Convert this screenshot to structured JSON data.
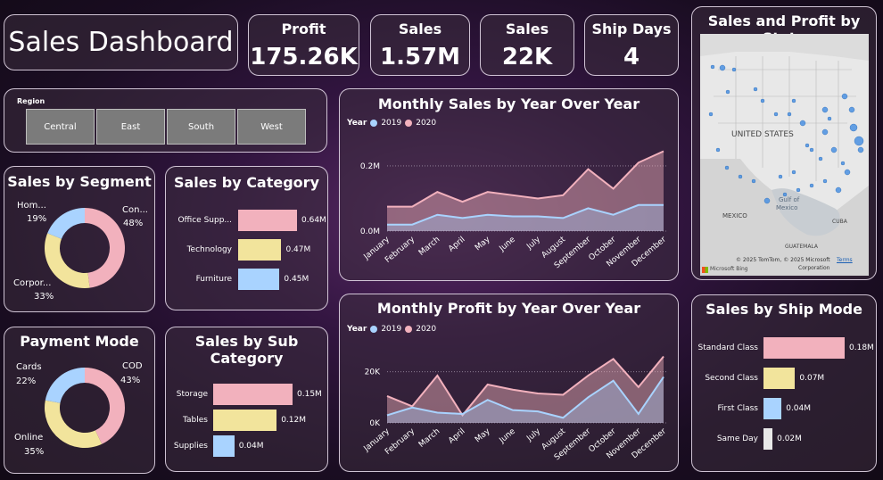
{
  "title": "Sales Dashboard",
  "kpis": {
    "profit": {
      "label": "Profit",
      "value": "175.26K"
    },
    "sales_amount": {
      "label": "Sales",
      "value": "1.57M"
    },
    "sales_count": {
      "label": "Sales",
      "value": "22K"
    },
    "ship_days": {
      "label": "Ship Days",
      "value": "4"
    }
  },
  "region": {
    "label": "Region",
    "options": [
      "Central",
      "East",
      "South",
      "West"
    ]
  },
  "segment": {
    "title": "Sales by Segment",
    "slices": [
      {
        "name": "Con...",
        "pct": "48%",
        "value": 48,
        "color": "#f2b1bd"
      },
      {
        "name": "Corpor...",
        "pct": "33%",
        "value": 33,
        "color": "#f2e49c"
      },
      {
        "name": "Hom...",
        "pct": "19%",
        "value": 19,
        "color": "#a9d3ff"
      }
    ]
  },
  "payment": {
    "title": "Payment Mode",
    "slices": [
      {
        "name": "COD",
        "pct": "43%",
        "value": 43,
        "color": "#f2b1bd"
      },
      {
        "name": "Online",
        "pct": "35%",
        "value": 35,
        "color": "#f2e49c"
      },
      {
        "name": "Cards",
        "pct": "22%",
        "value": 22,
        "color": "#a9d3ff"
      }
    ]
  },
  "category": {
    "title": "Sales by Category",
    "bars": [
      {
        "label": "Office Supp...",
        "value": 0.64,
        "text": "0.64M",
        "color": "#f2b1bd"
      },
      {
        "label": "Technology",
        "value": 0.47,
        "text": "0.47M",
        "color": "#f2e49c"
      },
      {
        "label": "Furniture",
        "value": 0.45,
        "text": "0.45M",
        "color": "#a9d3ff"
      }
    ]
  },
  "subcategory": {
    "title_line1": "Sales by Sub",
    "title_line2": "Category",
    "bars": [
      {
        "label": "Storage",
        "value": 0.15,
        "text": "0.15M",
        "color": "#f2b1bd"
      },
      {
        "label": "Tables",
        "value": 0.12,
        "text": "0.12M",
        "color": "#f2e49c"
      },
      {
        "label": "Supplies",
        "value": 0.04,
        "text": "0.04M",
        "color": "#a9d3ff"
      }
    ]
  },
  "shipmode": {
    "title": "Sales by Ship Mode",
    "bars": [
      {
        "label": "Standard Class",
        "value": 0.18,
        "text": "0.18M",
        "color": "#f2b1bd"
      },
      {
        "label": "Second Class",
        "value": 0.07,
        "text": "0.07M",
        "color": "#f2e49c"
      },
      {
        "label": "First Class",
        "value": 0.04,
        "text": "0.04M",
        "color": "#a9d3ff"
      },
      {
        "label": "Same Day",
        "value": 0.02,
        "text": "0.02M",
        "color": "#e8e8e8"
      }
    ]
  },
  "map": {
    "title": "Sales and Profit by State",
    "labels": {
      "country": "UNITED STATES",
      "gulf1": "Gulf of",
      "gulf2": "Mexico",
      "mexico": "MEXICO",
      "guatemala": "GUATEMALA",
      "cuba": "CUBA",
      "copyright": "© 2025 TomTom, © 2025 Microsoft",
      "corporation": "Corporation",
      "terms": "Terms",
      "bing": "Microsoft Bing"
    }
  },
  "chart_data": [
    {
      "type": "area",
      "title": "Monthly Sales by Year Over Year",
      "legend_title": "Year",
      "categories": [
        "January",
        "February",
        "March",
        "April",
        "May",
        "June",
        "July",
        "August",
        "September",
        "October",
        "November",
        "December"
      ],
      "yticks": [
        "0.0M",
        "0.2M"
      ],
      "ylim": [
        0,
        0.26
      ],
      "series": [
        {
          "name": "2019",
          "color": "#a9d3ff",
          "values": [
            0.02,
            0.02,
            0.05,
            0.04,
            0.05,
            0.045,
            0.045,
            0.04,
            0.07,
            0.05,
            0.08,
            0.08
          ]
        },
        {
          "name": "2020",
          "color": "#f2b1bd",
          "values": [
            0.075,
            0.075,
            0.12,
            0.09,
            0.12,
            0.11,
            0.1,
            0.11,
            0.19,
            0.13,
            0.21,
            0.245
          ]
        }
      ]
    },
    {
      "type": "area",
      "title": "Monthly Profit by Year Over Year",
      "legend_title": "Year",
      "categories": [
        "January",
        "February",
        "March",
        "April",
        "May",
        "June",
        "July",
        "August",
        "September",
        "October",
        "November",
        "December"
      ],
      "yticks": [
        "0K",
        "20K"
      ],
      "ylim": [
        0,
        30000
      ],
      "series": [
        {
          "name": "2019",
          "color": "#a9d3ff",
          "values": [
            3000,
            6000,
            4000,
            3500,
            9000,
            5000,
            4500,
            2000,
            10000,
            16500,
            3500,
            18000
          ]
        },
        {
          "name": "2020",
          "color": "#f2b1bd",
          "values": [
            10500,
            6500,
            18500,
            3000,
            15000,
            13000,
            11500,
            11000,
            18500,
            25000,
            14000,
            26000
          ]
        }
      ]
    }
  ]
}
